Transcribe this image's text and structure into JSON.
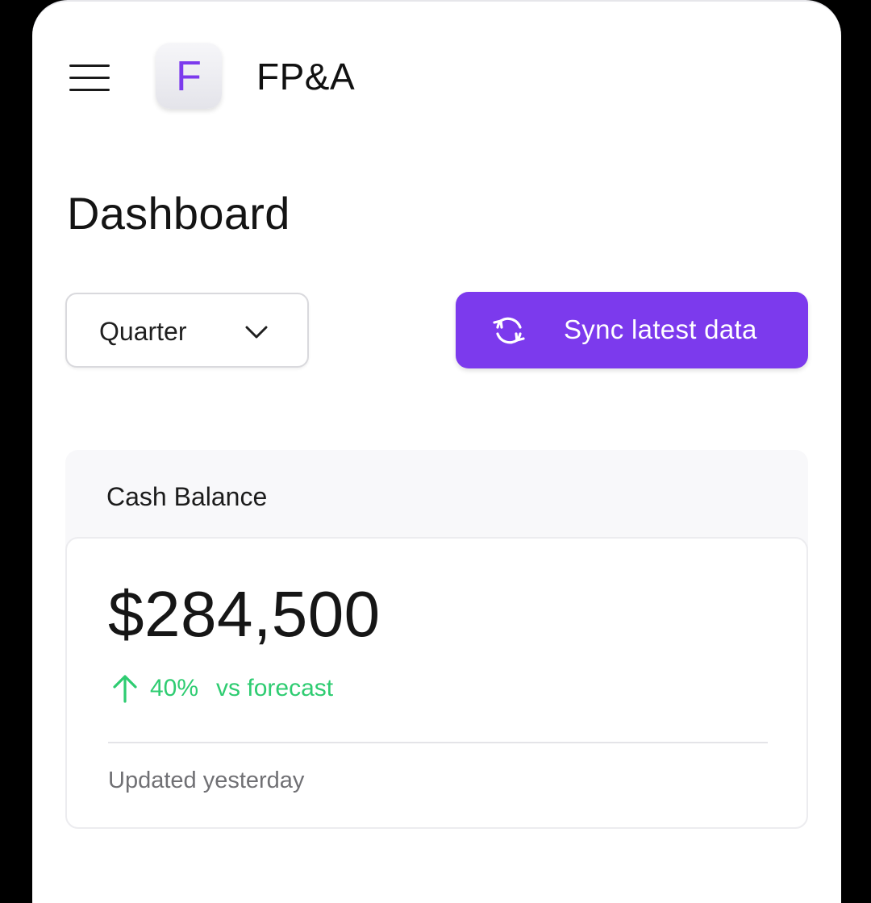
{
  "header": {
    "logo_letter": "F",
    "app_title": "FP&A"
  },
  "page": {
    "title": "Dashboard"
  },
  "controls": {
    "period_select": {
      "selected": "Quarter"
    },
    "sync_button_label": "Sync latest data"
  },
  "cash_card": {
    "title": "Cash Balance",
    "amount": "$284,500",
    "delta_percent": "40%",
    "delta_label": "vs forecast",
    "updated": "Updated yesterday"
  },
  "colors": {
    "accent": "#7c3aed",
    "positive": "#2ecc71"
  },
  "icons": {
    "menu": "hamburger-menu-icon",
    "select": "chevron-down-icon",
    "sync": "sync-icon",
    "delta": "arrow-up-icon"
  }
}
